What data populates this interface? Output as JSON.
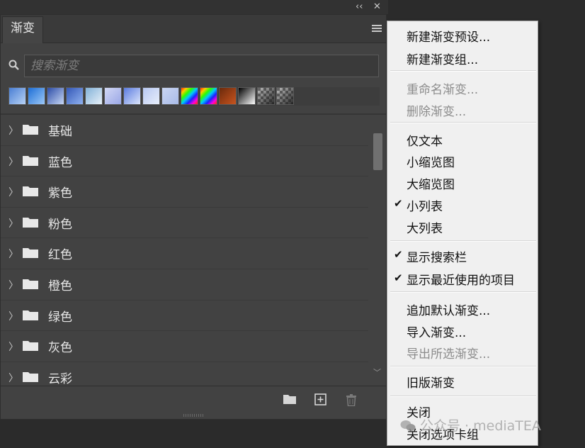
{
  "panel": {
    "tab_label": "渐变",
    "search_placeholder": "搜索渐变",
    "window_controls": {
      "collapse_icon": "‹‹",
      "close_icon": "✕"
    }
  },
  "recent_swatches": [
    {
      "name": "blue-1",
      "colors": [
        "#4a7fd4",
        "#b7d2f5"
      ]
    },
    {
      "name": "blue-2",
      "colors": [
        "#1e6fd6",
        "#9cc8f7"
      ]
    },
    {
      "name": "blue-3",
      "colors": [
        "#2e4ea8",
        "#c6d6f4"
      ]
    },
    {
      "name": "blue-4",
      "colors": [
        "#3558b8",
        "#8fb2ef"
      ]
    },
    {
      "name": "blue-5",
      "colors": [
        "#83b2d8",
        "#e7f0f8"
      ]
    },
    {
      "name": "blue-6",
      "colors": [
        "#d2d8f5",
        "#9aa7e6"
      ]
    },
    {
      "name": "blue-7",
      "colors": [
        "#5c7ce0",
        "#dbe5fb"
      ]
    },
    {
      "name": "blue-8",
      "colors": [
        "#b8c8f2",
        "#e7eefb"
      ]
    },
    {
      "name": "blue-9",
      "colors": [
        "#c9d5f2",
        "#a9bbe8"
      ]
    },
    {
      "name": "spectrum-1",
      "type": "spectrum"
    },
    {
      "name": "spectrum-2",
      "type": "spectrum"
    },
    {
      "name": "copper",
      "colors": [
        "#6b2a0c",
        "#c8541f"
      ]
    },
    {
      "name": "black-white",
      "colors": [
        "#000000",
        "#ffffff"
      ]
    },
    {
      "name": "transparent-1",
      "type": "transparent"
    },
    {
      "name": "transparent-2",
      "type": "transparent"
    }
  ],
  "groups": [
    {
      "label": "基础"
    },
    {
      "label": "蓝色"
    },
    {
      "label": "紫色"
    },
    {
      "label": "粉色"
    },
    {
      "label": "红色"
    },
    {
      "label": "橙色"
    },
    {
      "label": "绿色"
    },
    {
      "label": "灰色"
    },
    {
      "label": "云彩"
    }
  ],
  "menu": {
    "new_preset": "新建渐变预设...",
    "new_group": "新建渐变组...",
    "rename": "重命名渐变...",
    "delete": "删除渐变...",
    "text_only": "仅文本",
    "small_thumb": "小缩览图",
    "large_thumb": "大缩览图",
    "small_list": "小列表",
    "large_list": "大列表",
    "show_search": "显示搜索栏",
    "show_recent": "显示最近使用的项目",
    "append_default": "追加默认渐变...",
    "import": "导入渐变...",
    "export": "导出所选渐变...",
    "legacy": "旧版渐变",
    "close": "关闭",
    "close_group": "关闭选项卡组",
    "checkmark": "✔"
  },
  "watermark": "公众号 · mediaTEA",
  "colors": {
    "panel_bg": "#424242",
    "menu_bg": "#f0f0f0",
    "text": "#e6e6e6"
  }
}
